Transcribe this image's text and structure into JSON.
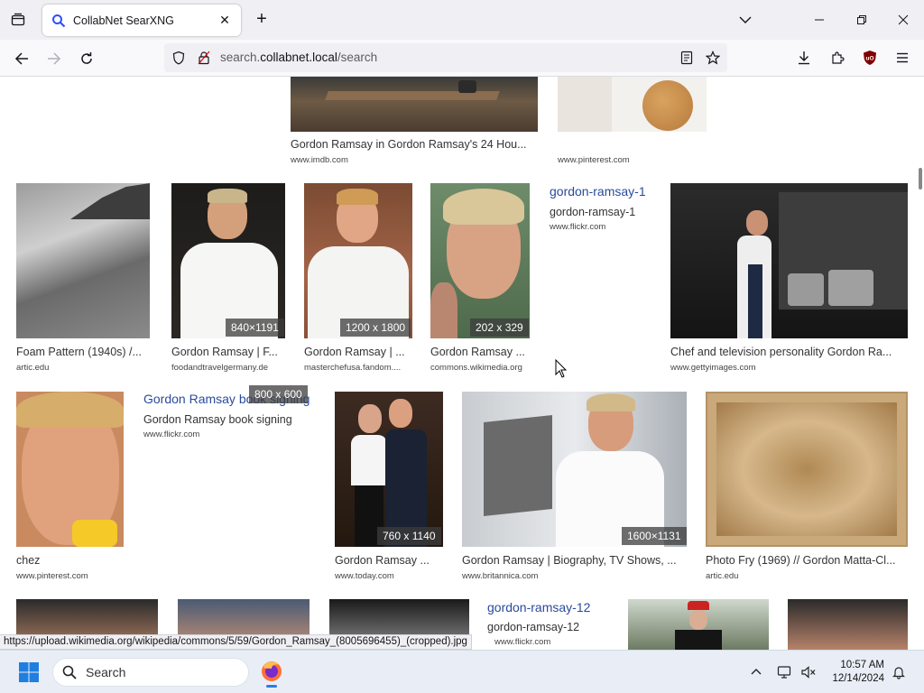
{
  "browser": {
    "tab_title": "CollabNet SearXNG",
    "url_prefix": "search.",
    "url_host": "collabnet.local",
    "url_path": "/search",
    "status_url": "https://upload.wikimedia.org/wikipedia/commons/5/59/Gordon_Ramsay_(8005696455)_(cropped).jpg"
  },
  "results": {
    "row0": [
      {
        "title": "Gordon Ramsay in Gordon Ramsay's 24 Hou...",
        "url": "www.imdb.com"
      },
      {
        "title": "",
        "url": "www.pinterest.com"
      }
    ],
    "row1": [
      {
        "title": "Foam Pattern (1940s) /...",
        "url": "artic.edu",
        "res": ""
      },
      {
        "title": "Gordon Ramsay | F...",
        "url": "foodandtravelgermany.de",
        "res": "840×1191"
      },
      {
        "title": "Gordon Ramsay | ...",
        "url": "masterchefusa.fandom....",
        "res": "1200 x 1800"
      },
      {
        "title": "Gordon Ramsay ...",
        "url": "commons.wikimedia.org",
        "res": "202 x 329"
      },
      {
        "link": "gordon-ramsay-1",
        "title": "gordon-ramsay-1",
        "url": "www.flickr.com"
      },
      {
        "title": "Chef and television personality Gordon Ra...",
        "url": "www.gettyimages.com",
        "res": ""
      }
    ],
    "row2": [
      {
        "title": "chez",
        "url": "www.pinterest.com"
      },
      {
        "link": "Gordon Ramsay book signing",
        "title": "Gordon Ramsay book signing",
        "url": "www.flickr.com",
        "res": "800 x 600"
      },
      {
        "title": "Gordon Ramsay ...",
        "url": "www.today.com",
        "res": "760 x 1140"
      },
      {
        "title": "Gordon Ramsay | Biography, TV Shows, ...",
        "url": "www.britannica.com",
        "res": "1600×1131"
      },
      {
        "title": "Photo Fry (1969) // Gordon Matta-Cl...",
        "url": "artic.edu"
      }
    ],
    "row3": [
      {
        "link": "gordon-ramsay-12",
        "title": "gordon-ramsay-12",
        "url": "www.flickr.com"
      }
    ]
  },
  "taskbar": {
    "search_label": "Search",
    "time": "10:57 AM",
    "date": "12/14/2024"
  },
  "colors": {
    "link": "#2a4b9b",
    "accent": "#2b7de0",
    "ublock": "#800000"
  }
}
